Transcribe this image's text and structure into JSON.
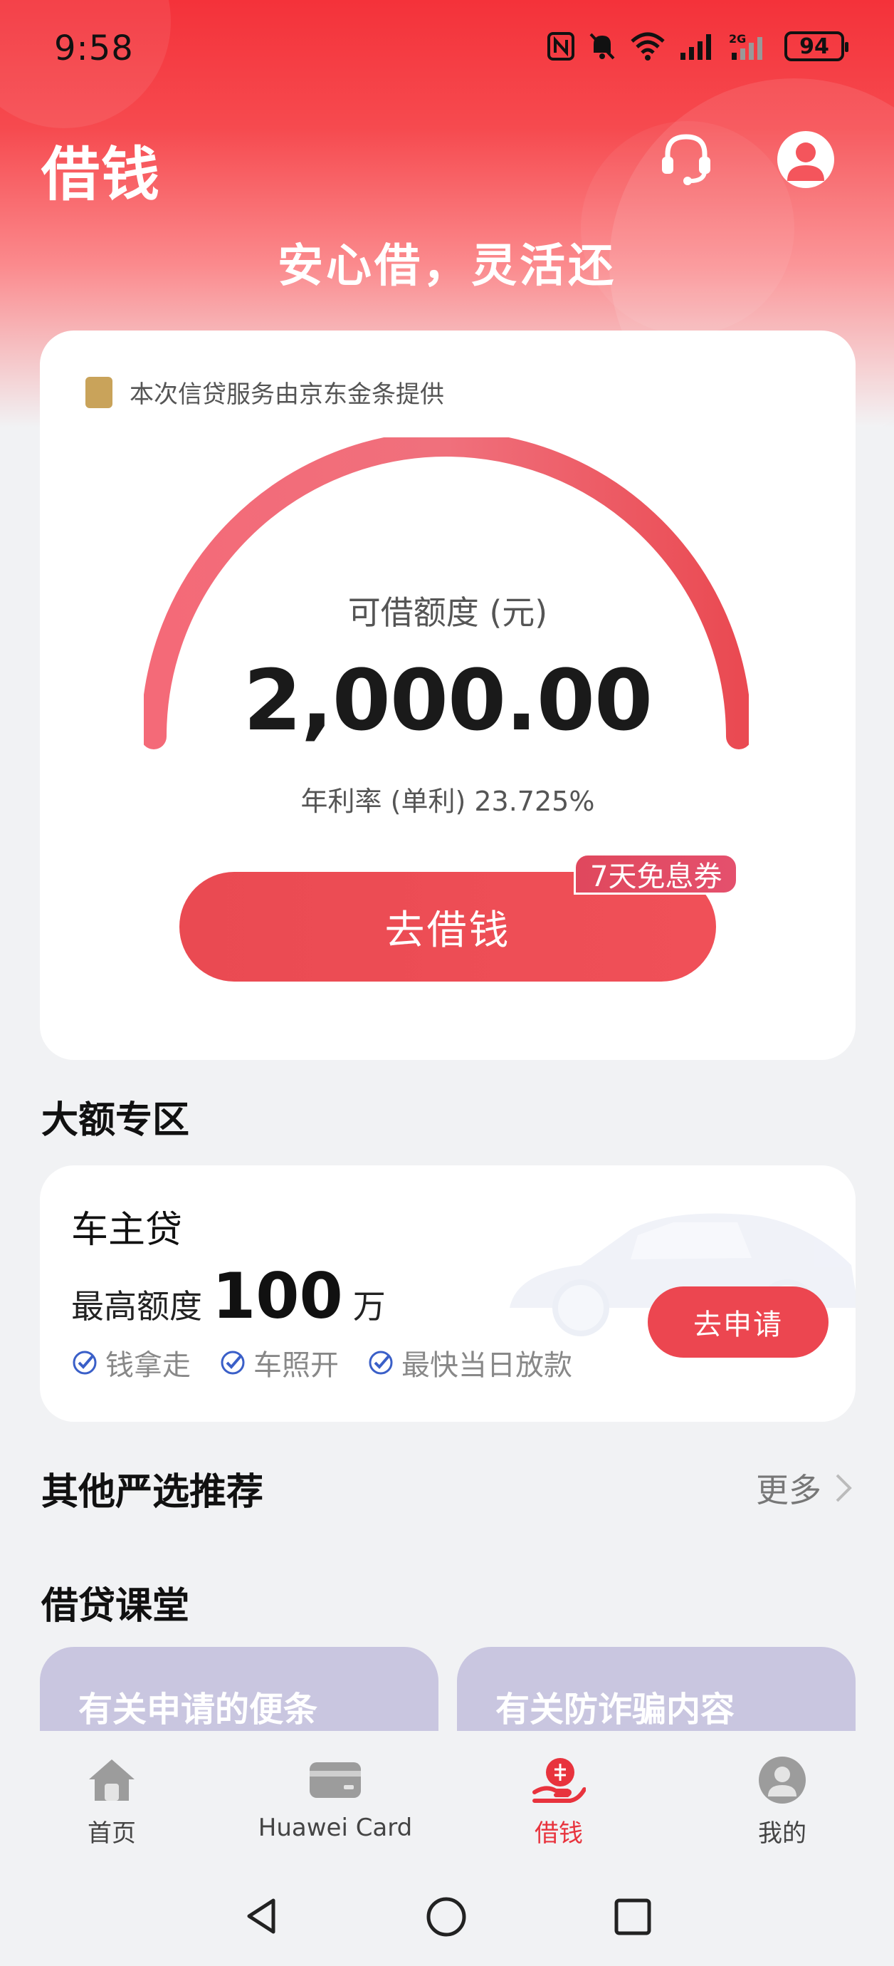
{
  "status_bar": {
    "time": "9:58",
    "battery": "94",
    "network": "2G"
  },
  "header": {
    "title": "借钱",
    "slogan": "安心借，灵活还"
  },
  "loan_card": {
    "provider_logo_text": "金条",
    "provider_text": "本次信贷服务由京东金条提供",
    "limit_label": "可借额度 (元)",
    "limit_amount": "2,000.00",
    "rate_text": "年利率 (单利) 23.725%",
    "borrow_button": "去借钱",
    "coupon_badge": "7天免息券"
  },
  "large_zone": {
    "section_title": "大额专区",
    "product_title": "车主贷",
    "max_label": "最高额度",
    "max_value": "100",
    "max_unit": "万",
    "features": [
      "钱拿走",
      "车照开",
      "最快当日放款"
    ],
    "apply_button": "去申请"
  },
  "recommend": {
    "section_title": "其他严选推荐",
    "more_label": "更多"
  },
  "classroom": {
    "section_title": "借贷课堂",
    "cards": [
      "有关申请的便条",
      "有关防诈骗内容"
    ]
  },
  "bottom_nav": [
    {
      "label": "首页",
      "icon": "home-icon"
    },
    {
      "label": "Huawei Card",
      "icon": "card-icon"
    },
    {
      "label": "借钱",
      "icon": "borrow-icon",
      "active": true
    },
    {
      "label": "我的",
      "icon": "profile-icon"
    }
  ],
  "colors": {
    "accent": "#ec4650",
    "active_nav": "#e8333d",
    "header_red": "#f4323a"
  }
}
